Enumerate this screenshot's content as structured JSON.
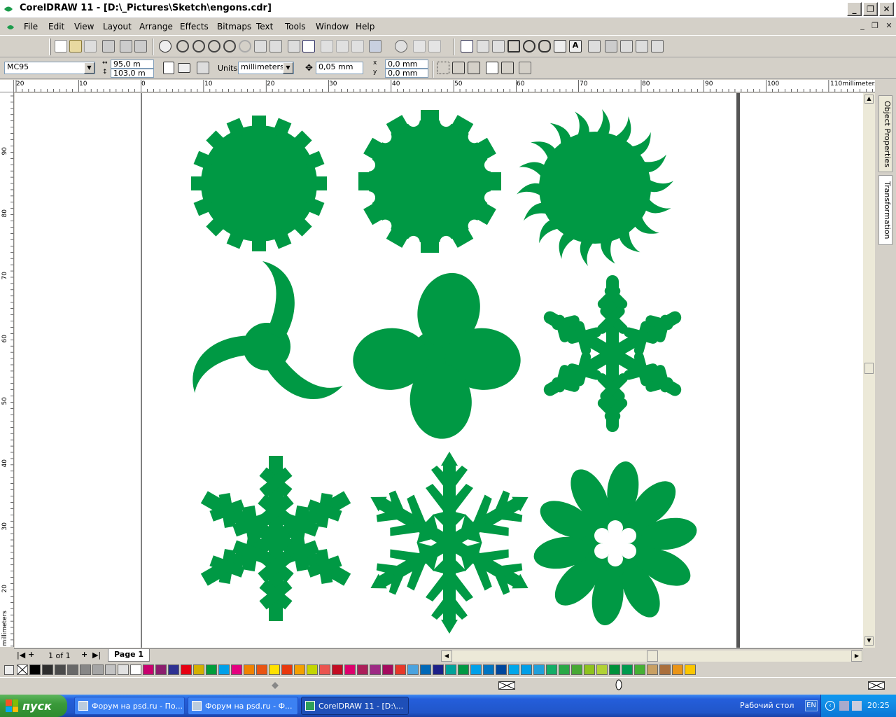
{
  "window": {
    "title": "CorelDRAW 11 - [D:\\_Pictures\\Sketch\\engons.cdr]"
  },
  "menu": [
    "File",
    "Edit",
    "View",
    "Layout",
    "Arrange",
    "Effects",
    "Bitmaps",
    "Text",
    "Tools",
    "Window",
    "Help"
  ],
  "property_bar": {
    "paper_type": "MC95",
    "width": "95,0 m",
    "height": "103,0 m",
    "units_label": "Units:",
    "units_value": "millimeters",
    "nudge": "0,05 mm",
    "dup_x": "0,0 mm",
    "dup_y": "0,0 mm"
  },
  "ruler": {
    "unit": "millimeters",
    "h_labels": [
      "20",
      "10",
      "0",
      "10",
      "20",
      "30",
      "40",
      "50",
      "60",
      "70",
      "80",
      "90",
      "100",
      "110"
    ],
    "v_labels": [
      "90",
      "80",
      "70",
      "60",
      "50",
      "40",
      "30",
      "20"
    ]
  },
  "dockers": [
    "Object Properties",
    "Transformation"
  ],
  "pagebar": {
    "count": "1 of 1",
    "tab": "Page 1"
  },
  "palette_colors": [
    "#000000",
    "#2e2e2e",
    "#4b4b4b",
    "#696969",
    "#878787",
    "#a5a5a5",
    "#c3c3c3",
    "#e1e1e1",
    "#ffffff",
    "#c8006e",
    "#8b1e6e",
    "#2e3192",
    "#e60012",
    "#d4b000",
    "#009e3b",
    "#00a0e9",
    "#e4007f",
    "#f08300",
    "#e95413",
    "#ffe100",
    "#e8380d",
    "#f4a000",
    "#c3d600",
    "#ea5550",
    "#c30d23",
    "#dd006c",
    "#ac1f5a",
    "#9d2a84",
    "#a40b5e",
    "#e83828",
    "#4aa3df",
    "#0068b7",
    "#1d2088",
    "#00a29a",
    "#009944",
    "#00a0e9",
    "#0075c2",
    "#00479d",
    "#00a7ea",
    "#009fe8",
    "#21a0db",
    "#13ae67",
    "#2aa846",
    "#48a935",
    "#8fc31f",
    "#b2d235",
    "#00913a",
    "#009b4e",
    "#46b035",
    "#c9a063",
    "#aa6f3c",
    "#ea9518",
    "#fbc600"
  ],
  "taskbar": {
    "start": "пуск",
    "items": [
      "Форум на psd.ru - По...",
      "Форум на psd.ru - Ф...",
      "CorelDRAW 11 - [D:\\..."
    ],
    "workspace": "Рабочий стол",
    "lang": "EN",
    "clock": "20:25"
  },
  "shapes": [
    "gear-16",
    "gear-12",
    "sun-swirl",
    "triskelion",
    "clover",
    "snowflake-rounded",
    "snowflake-branch",
    "snowflake-arrow",
    "flower"
  ],
  "colors": {
    "shape_fill": "#009944",
    "canvas": "#ffffff",
    "chrome": "#d4d0c8"
  }
}
